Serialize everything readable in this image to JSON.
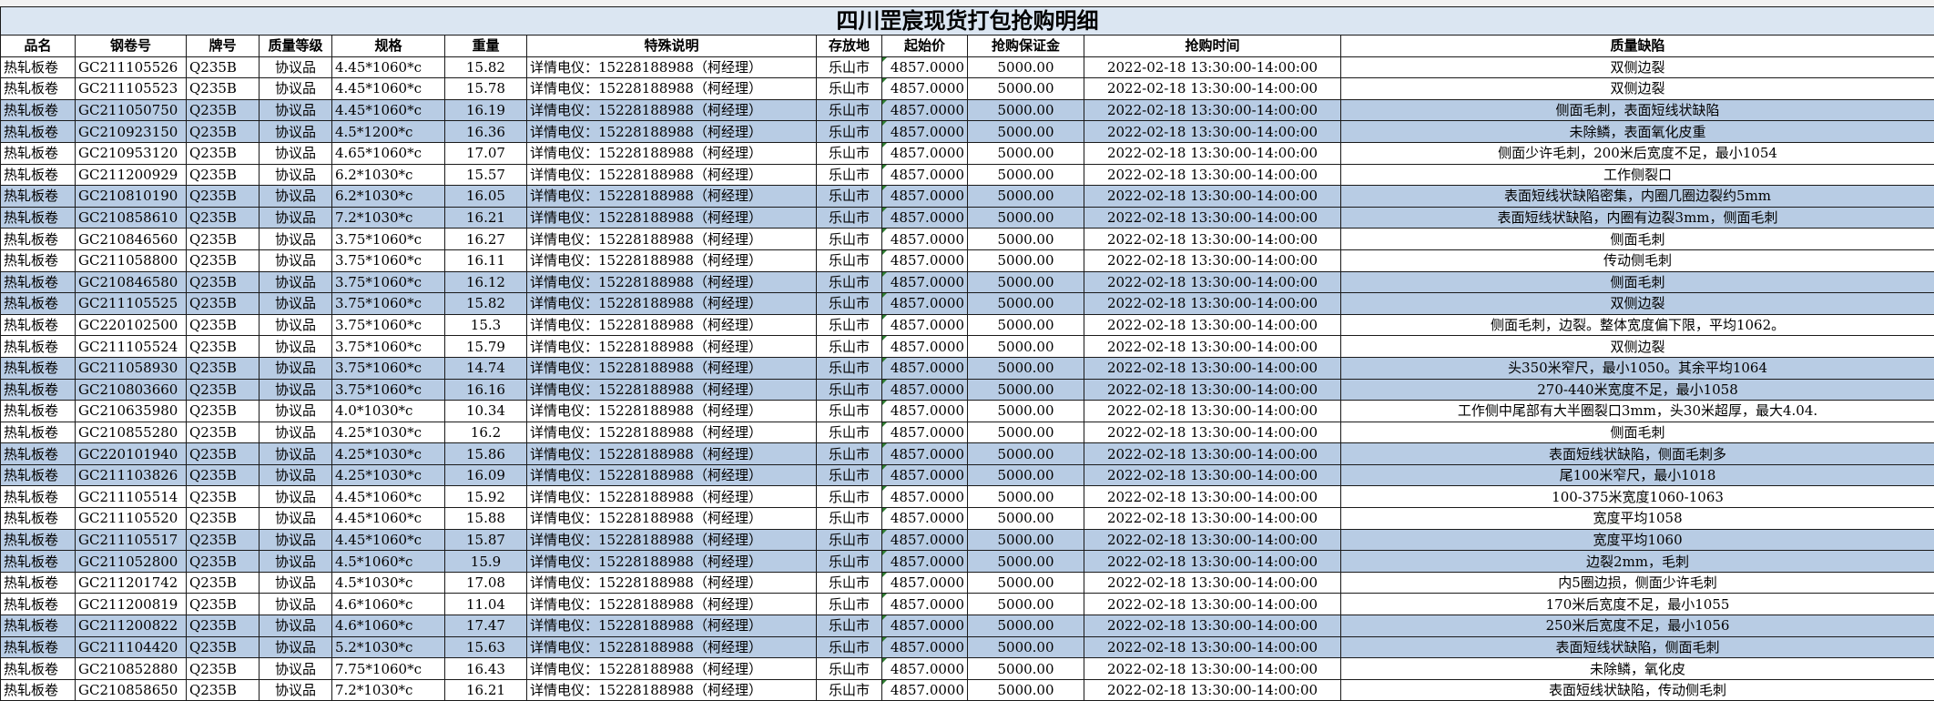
{
  "title": "四川罡宸现货打包抢购明细",
  "headers": [
    "品名",
    "钢卷号",
    "牌号",
    "质量等级",
    "规格",
    "重量",
    "特殊说明",
    "存放地",
    "起始价",
    "抢购保证金",
    "抢购时间",
    "质量缺陷"
  ],
  "rows": [
    {
      "hl": false,
      "c": [
        "热轧板卷",
        "GC211105526",
        "Q235B",
        "协议品",
        "4.45*1060*c",
        "15.82",
        "详情电仪：15228188988（柯经理）",
        "乐山市",
        "4857.0000",
        "5000.00",
        "2022-02-18 13:30:00-14:00:00",
        "双侧边裂"
      ]
    },
    {
      "hl": false,
      "c": [
        "热轧板卷",
        "GC211105523",
        "Q235B",
        "协议品",
        "4.45*1060*c",
        "15.78",
        "详情电仪：15228188988（柯经理）",
        "乐山市",
        "4857.0000",
        "5000.00",
        "2022-02-18 13:30:00-14:00:00",
        "双侧边裂"
      ]
    },
    {
      "hl": true,
      "c": [
        "热轧板卷",
        "GC211050750",
        "Q235B",
        "协议品",
        "4.45*1060*c",
        "16.19",
        "详情电仪：15228188988（柯经理）",
        "乐山市",
        "4857.0000",
        "5000.00",
        "2022-02-18 13:30:00-14:00:00",
        "侧面毛刺，表面短线状缺陷"
      ]
    },
    {
      "hl": true,
      "c": [
        "热轧板卷",
        "GC210923150",
        "Q235B",
        "协议品",
        "4.5*1200*c",
        "16.36",
        "详情电仪：15228188988（柯经理）",
        "乐山市",
        "4857.0000",
        "5000.00",
        "2022-02-18 13:30:00-14:00:00",
        "未除鳞，表面氧化皮重"
      ]
    },
    {
      "hl": false,
      "c": [
        "热轧板卷",
        "GC210953120",
        "Q235B",
        "协议品",
        "4.65*1060*c",
        "17.07",
        "详情电仪：15228188988（柯经理）",
        "乐山市",
        "4857.0000",
        "5000.00",
        "2022-02-18 13:30:00-14:00:00",
        "侧面少许毛刺，200米后宽度不足，最小1054"
      ]
    },
    {
      "hl": false,
      "c": [
        "热轧板卷",
        "GC211200929",
        "Q235B",
        "协议品",
        "6.2*1030*c",
        "15.57",
        "详情电仪：15228188988（柯经理）",
        "乐山市",
        "4857.0000",
        "5000.00",
        "2022-02-18 13:30:00-14:00:00",
        "工作侧裂口"
      ]
    },
    {
      "hl": true,
      "c": [
        "热轧板卷",
        "GC210810190",
        "Q235B",
        "协议品",
        "6.2*1030*c",
        "16.05",
        "详情电仪：15228188988（柯经理）",
        "乐山市",
        "4857.0000",
        "5000.00",
        "2022-02-18 13:30:00-14:00:00",
        "表面短线状缺陷密集，内圈几圈边裂约5mm"
      ]
    },
    {
      "hl": true,
      "c": [
        "热轧板卷",
        "GC210858610",
        "Q235B",
        "协议品",
        "7.2*1030*c",
        "16.21",
        "详情电仪：15228188988（柯经理）",
        "乐山市",
        "4857.0000",
        "5000.00",
        "2022-02-18 13:30:00-14:00:00",
        "表面短线状缺陷，内圈有边裂3mm，侧面毛刺"
      ]
    },
    {
      "hl": false,
      "c": [
        "热轧板卷",
        "GC210846560",
        "Q235B",
        "协议品",
        "3.75*1060*c",
        "16.27",
        "详情电仪：15228188988（柯经理）",
        "乐山市",
        "4857.0000",
        "5000.00",
        "2022-02-18 13:30:00-14:00:00",
        "侧面毛刺"
      ]
    },
    {
      "hl": false,
      "c": [
        "热轧板卷",
        "GC211058800",
        "Q235B",
        "协议品",
        "3.75*1060*c",
        "16.11",
        "详情电仪：15228188988（柯经理）",
        "乐山市",
        "4857.0000",
        "5000.00",
        "2022-02-18 13:30:00-14:00:00",
        "传动侧毛刺"
      ]
    },
    {
      "hl": true,
      "c": [
        "热轧板卷",
        "GC210846580",
        "Q235B",
        "协议品",
        "3.75*1060*c",
        "16.12",
        "详情电仪：15228188988（柯经理）",
        "乐山市",
        "4857.0000",
        "5000.00",
        "2022-02-18 13:30:00-14:00:00",
        "侧面毛刺"
      ]
    },
    {
      "hl": true,
      "c": [
        "热轧板卷",
        "GC211105525",
        "Q235B",
        "协议品",
        "3.75*1060*c",
        "15.82",
        "详情电仪：15228188988（柯经理）",
        "乐山市",
        "4857.0000",
        "5000.00",
        "2022-02-18 13:30:00-14:00:00",
        "双侧边裂"
      ]
    },
    {
      "hl": false,
      "c": [
        "热轧板卷",
        "GC220102500",
        "Q235B",
        "协议品",
        "3.75*1060*c",
        "15.3",
        "详情电仪：15228188988（柯经理）",
        "乐山市",
        "4857.0000",
        "5000.00",
        "2022-02-18 13:30:00-14:00:00",
        "侧面毛刺，边裂。整体宽度偏下限，平均1062。"
      ]
    },
    {
      "hl": false,
      "c": [
        "热轧板卷",
        "GC211105524",
        "Q235B",
        "协议品",
        "3.75*1060*c",
        "15.79",
        "详情电仪：15228188988（柯经理）",
        "乐山市",
        "4857.0000",
        "5000.00",
        "2022-02-18 13:30:00-14:00:00",
        "双侧边裂"
      ]
    },
    {
      "hl": true,
      "c": [
        "热轧板卷",
        "GC211058930",
        "Q235B",
        "协议品",
        "3.75*1060*c",
        "14.74",
        "详情电仪：15228188988（柯经理）",
        "乐山市",
        "4857.0000",
        "5000.00",
        "2022-02-18 13:30:00-14:00:00",
        "头350米窄尺，最小1050。其余平均1064"
      ]
    },
    {
      "hl": true,
      "c": [
        "热轧板卷",
        "GC210803660",
        "Q235B",
        "协议品",
        "3.75*1060*c",
        "16.16",
        "详情电仪：15228188988（柯经理）",
        "乐山市",
        "4857.0000",
        "5000.00",
        "2022-02-18 13:30:00-14:00:00",
        "270-440米宽度不足，最小1058"
      ]
    },
    {
      "hl": false,
      "c": [
        "热轧板卷",
        "GC210635980",
        "Q235B",
        "协议品",
        "4.0*1030*c",
        "10.34",
        "详情电仪：15228188988（柯经理）",
        "乐山市",
        "4857.0000",
        "5000.00",
        "2022-02-18 13:30:00-14:00:00",
        "工作侧中尾部有大半圈裂口3mm，头30米超厚，最大4.04."
      ]
    },
    {
      "hl": false,
      "c": [
        "热轧板卷",
        "GC210855280",
        "Q235B",
        "协议品",
        "4.25*1030*c",
        "16.2",
        "详情电仪：15228188988（柯经理）",
        "乐山市",
        "4857.0000",
        "5000.00",
        "2022-02-18 13:30:00-14:00:00",
        "侧面毛刺"
      ]
    },
    {
      "hl": true,
      "c": [
        "热轧板卷",
        "GC220101940",
        "Q235B",
        "协议品",
        "4.25*1030*c",
        "15.86",
        "详情电仪：15228188988（柯经理）",
        "乐山市",
        "4857.0000",
        "5000.00",
        "2022-02-18 13:30:00-14:00:00",
        "表面短线状缺陷，侧面毛刺多"
      ]
    },
    {
      "hl": true,
      "c": [
        "热轧板卷",
        "GC211103826",
        "Q235B",
        "协议品",
        "4.25*1030*c",
        "16.09",
        "详情电仪：15228188988（柯经理）",
        "乐山市",
        "4857.0000",
        "5000.00",
        "2022-02-18 13:30:00-14:00:00",
        "尾100米窄尺，最小1018"
      ]
    },
    {
      "hl": false,
      "c": [
        "热轧板卷",
        "GC211105514",
        "Q235B",
        "协议品",
        "4.45*1060*c",
        "15.92",
        "详情电仪：15228188988（柯经理）",
        "乐山市",
        "4857.0000",
        "5000.00",
        "2022-02-18 13:30:00-14:00:00",
        "100-375米宽度1060-1063"
      ]
    },
    {
      "hl": false,
      "c": [
        "热轧板卷",
        "GC211105520",
        "Q235B",
        "协议品",
        "4.45*1060*c",
        "15.88",
        "详情电仪：15228188988（柯经理）",
        "乐山市",
        "4857.0000",
        "5000.00",
        "2022-02-18 13:30:00-14:00:00",
        "宽度平均1058"
      ]
    },
    {
      "hl": true,
      "c": [
        "热轧板卷",
        "GC211105517",
        "Q235B",
        "协议品",
        "4.45*1060*c",
        "15.87",
        "详情电仪：15228188988（柯经理）",
        "乐山市",
        "4857.0000",
        "5000.00",
        "2022-02-18 13:30:00-14:00:00",
        "宽度平均1060"
      ]
    },
    {
      "hl": true,
      "c": [
        "热轧板卷",
        "GC211052800",
        "Q235B",
        "协议品",
        "4.5*1060*c",
        "15.9",
        "详情电仪：15228188988（柯经理）",
        "乐山市",
        "4857.0000",
        "5000.00",
        "2022-02-18 13:30:00-14:00:00",
        "边裂2mm，毛刺"
      ]
    },
    {
      "hl": false,
      "c": [
        "热轧板卷",
        "GC211201742",
        "Q235B",
        "协议品",
        "4.5*1030*c",
        "17.08",
        "详情电仪：15228188988（柯经理）",
        "乐山市",
        "4857.0000",
        "5000.00",
        "2022-02-18 13:30:00-14:00:00",
        "内5圈边损，侧面少许毛刺"
      ]
    },
    {
      "hl": false,
      "c": [
        "热轧板卷",
        "GC211200819",
        "Q235B",
        "协议品",
        "4.6*1060*c",
        "11.04",
        "详情电仪：15228188988（柯经理）",
        "乐山市",
        "4857.0000",
        "5000.00",
        "2022-02-18 13:30:00-14:00:00",
        "170米后宽度不足，最小1055"
      ]
    },
    {
      "hl": true,
      "c": [
        "热轧板卷",
        "GC211200822",
        "Q235B",
        "协议品",
        "4.6*1060*c",
        "17.47",
        "详情电仪：15228188988（柯经理）",
        "乐山市",
        "4857.0000",
        "5000.00",
        "2022-02-18 13:30:00-14:00:00",
        "250米后宽度不足，最小1056"
      ]
    },
    {
      "hl": true,
      "c": [
        "热轧板卷",
        "GC211104420",
        "Q235B",
        "协议品",
        "5.2*1030*c",
        "15.63",
        "详情电仪：15228188988（柯经理）",
        "乐山市",
        "4857.0000",
        "5000.00",
        "2022-02-18 13:30:00-14:00:00",
        "表面短线状缺陷，侧面毛刺"
      ]
    },
    {
      "hl": false,
      "c": [
        "热轧板卷",
        "GC210852880",
        "Q235B",
        "协议品",
        "7.75*1060*c",
        "16.43",
        "详情电仪：15228188988（柯经理）",
        "乐山市",
        "4857.0000",
        "5000.00",
        "2022-02-18 13:30:00-14:00:00",
        "未除鳞，氧化皮"
      ]
    },
    {
      "hl": false,
      "c": [
        "热轧板卷",
        "GC210858650",
        "Q235B",
        "协议品",
        "7.2*1030*c",
        "16.21",
        "详情电仪：15228188988（柯经理）",
        "乐山市",
        "4857.0000",
        "5000.00",
        "2022-02-18 13:30:00-14:00:00",
        "表面短线状缺陷，传动侧毛刺"
      ]
    }
  ]
}
